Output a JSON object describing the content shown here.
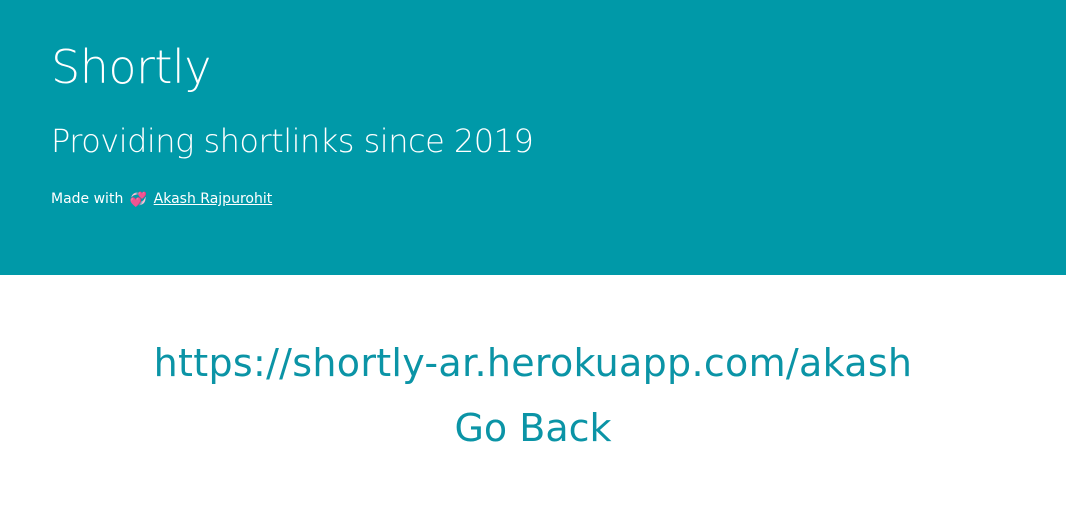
{
  "hero": {
    "title": "Shortly",
    "subtitle": "Providing shortlinks since 2019",
    "credit_prefix": "Made with",
    "heart_icon": "💞",
    "author_link": "Akash Rajpurohit",
    "background_color": "#0099a8"
  },
  "main": {
    "short_url": "https://shortly-ar.herokuapp.com/akash",
    "go_back": "Go Back",
    "link_color": "#0b94a6"
  }
}
